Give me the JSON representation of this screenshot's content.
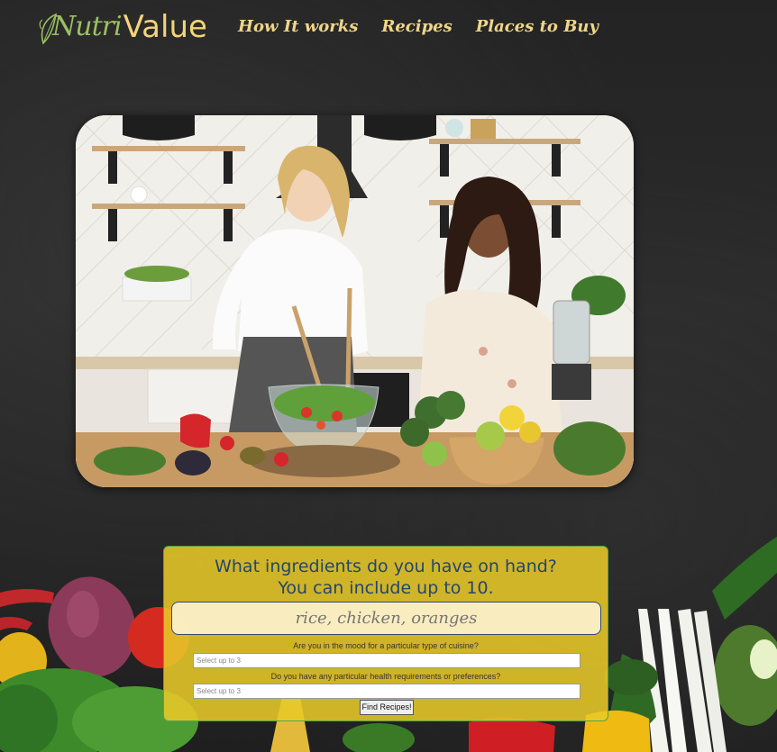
{
  "brand": {
    "logo_part1": "Nutri",
    "logo_part2": "Value"
  },
  "nav": {
    "items": [
      "How It works",
      "Recipes",
      "Places to Buy"
    ]
  },
  "search_panel": {
    "heading_line1": "What ingredients do you have on hand?",
    "heading_line2": "You can include up to 10.",
    "ingredients_placeholder": "rice, chicken, oranges",
    "cuisine_question": "Are you in the mood for a particular type of cuisine?",
    "cuisine_placeholder": "Select up to 3",
    "health_question": "Do you have any particular health requirements or preferences?",
    "health_placeholder": "Select up to 3",
    "submit_label": "Find Recipes!"
  },
  "colors": {
    "accent_gold": "#f0d68a",
    "logo_green": "#9bbf63",
    "panel_yellow": "#e8c828",
    "heading_blue": "#23466e"
  }
}
